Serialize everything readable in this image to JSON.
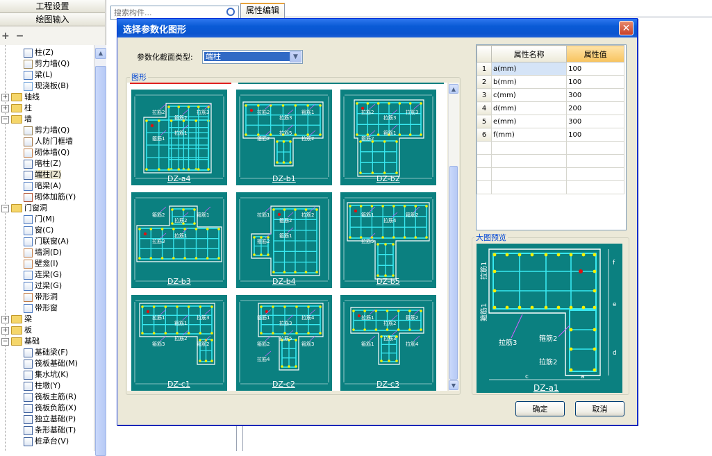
{
  "left_panel": {
    "header_top": "工程设置",
    "header_second": "绘图输入",
    "toolbar_add": "+",
    "toolbar_remove": "−",
    "tree": [
      {
        "label": "柱(Z)",
        "icon": "column-icon",
        "level": 2
      },
      {
        "label": "剪力墙(Q)",
        "icon": "shear-wall-icon",
        "level": 2
      },
      {
        "label": "梁(L)",
        "icon": "beam-icon",
        "level": 2
      },
      {
        "label": "现浇板(B)",
        "icon": "slab-icon",
        "level": 2
      },
      {
        "label": "轴线",
        "icon": "folder-icon",
        "level": 1,
        "expander": "+"
      },
      {
        "label": "柱",
        "icon": "folder-icon",
        "level": 1,
        "expander": "+"
      },
      {
        "label": "墙",
        "icon": "folder-icon",
        "level": 1,
        "expander": "−"
      },
      {
        "label": "剪力墙(Q)",
        "icon": "shear-wall-icon",
        "level": 2
      },
      {
        "label": "人防门框墙",
        "icon": "door-frame-wall-icon",
        "level": 2
      },
      {
        "label": "砌体墙(Q)",
        "icon": "masonry-wall-icon",
        "level": 2
      },
      {
        "label": "暗柱(Z)",
        "icon": "hidden-column-icon",
        "level": 2
      },
      {
        "label": "端柱(Z)",
        "icon": "end-column-icon",
        "level": 2
      },
      {
        "label": "暗梁(A)",
        "icon": "hidden-beam-icon",
        "level": 2
      },
      {
        "label": "砌体加筋(Y)",
        "icon": "masonry-rebar-icon",
        "level": 2
      },
      {
        "label": "门窗洞",
        "icon": "folder-icon",
        "level": 1,
        "expander": "−"
      },
      {
        "label": "门(M)",
        "icon": "door-icon",
        "level": 2
      },
      {
        "label": "窗(C)",
        "icon": "window-icon",
        "level": 2
      },
      {
        "label": "门联窗(A)",
        "icon": "door-window-icon",
        "level": 2
      },
      {
        "label": "墙洞(D)",
        "icon": "wall-hole-icon",
        "level": 2
      },
      {
        "label": "壁龛(I)",
        "icon": "niche-icon",
        "level": 2
      },
      {
        "label": "连梁(G)",
        "icon": "link-beam-icon",
        "level": 2
      },
      {
        "label": "过梁(G)",
        "icon": "lintel-icon",
        "level": 2
      },
      {
        "label": "带形洞",
        "icon": "strip-hole-icon",
        "level": 2
      },
      {
        "label": "带形窗",
        "icon": "strip-window-icon",
        "level": 2
      },
      {
        "label": "梁",
        "icon": "folder-icon",
        "level": 1,
        "expander": "+"
      },
      {
        "label": "板",
        "icon": "folder-icon",
        "level": 1,
        "expander": "+"
      },
      {
        "label": "基础",
        "icon": "folder-icon",
        "level": 1,
        "expander": "−"
      },
      {
        "label": "基础梁(F)",
        "icon": "foundation-beam-icon",
        "level": 2
      },
      {
        "label": "筏板基础(M)",
        "icon": "raft-foundation-icon",
        "level": 2
      },
      {
        "label": "集水坑(K)",
        "icon": "sump-icon",
        "level": 2
      },
      {
        "label": "柱墩(Y)",
        "icon": "pier-icon",
        "level": 2
      },
      {
        "label": "筏板主筋(R)",
        "icon": "raft-main-rebar-icon",
        "level": 2
      },
      {
        "label": "筏板负筋(X)",
        "icon": "raft-neg-rebar-icon",
        "level": 2
      },
      {
        "label": "独立基础(P)",
        "icon": "isolated-foundation-icon",
        "level": 2
      },
      {
        "label": "条形基础(T)",
        "icon": "strip-foundation-icon",
        "level": 2
      },
      {
        "label": "桩承台(V)",
        "icon": "pile-cap-icon",
        "level": 2
      }
    ]
  },
  "search": {
    "placeholder": "搜索构件..."
  },
  "tabs": [
    {
      "label": "属性编辑"
    }
  ],
  "dialog": {
    "title": "选择参数化图形",
    "type_label": "参数化截面类型:",
    "type_value": "端柱",
    "graph_group_label": "图形",
    "shapes": [
      {
        "name": "DZ-a4",
        "labels": [
          "拉筋2",
          "箍筋2",
          "拉筋3",
          "箍筋1",
          "拉筋1"
        ]
      },
      {
        "name": "DZ-b1",
        "labels": [
          "拉筋2",
          "拉筋3",
          "箍筋1",
          "箍筋2",
          "拉筋5",
          "拉筋2"
        ]
      },
      {
        "name": "DZ-b2",
        "labels": [
          "拉筋2",
          "拉筋3",
          "拉筋3",
          "箍筋2",
          "箍筋1"
        ]
      },
      {
        "name": "DZ-b3",
        "labels": [
          "箍筋2",
          "拉筋2",
          "箍筋1",
          "拉筋3",
          "拉筋1"
        ]
      },
      {
        "name": "DZ-b4",
        "labels": [
          "拉筋1",
          "箍筋2",
          "拉筋2",
          "箍筋2",
          "箍筋1"
        ]
      },
      {
        "name": "DZ-b5",
        "labels": [
          "箍筋1",
          "拉筋4",
          "箍筋2",
          "拉筋5"
        ]
      },
      {
        "name": "DZ-c1",
        "labels": [
          "拉筋1",
          "箍筋1",
          "拉筋3",
          "箍筋3",
          "拉筋2",
          "箍筋2"
        ]
      },
      {
        "name": "DZ-c2",
        "labels": [
          "箍筋1",
          "拉筋3",
          "拉筋4",
          "箍筋2",
          "拉筋5",
          "箍筋3",
          "拉筋4"
        ]
      },
      {
        "name": "DZ-c3",
        "labels": [
          "拉筋1",
          "拉筋2",
          "箍筋2",
          "箍筋1",
          "拉筋3",
          "拉筋4"
        ]
      }
    ],
    "properties": {
      "col_name": "属性名称",
      "col_value": "属性值",
      "rows": [
        {
          "idx": "1",
          "name": "a(mm)",
          "value": "100"
        },
        {
          "idx": "2",
          "name": "b(mm)",
          "value": "100"
        },
        {
          "idx": "3",
          "name": "c(mm)",
          "value": "300"
        },
        {
          "idx": "4",
          "name": "d(mm)",
          "value": "200"
        },
        {
          "idx": "5",
          "name": "e(mm)",
          "value": "300"
        },
        {
          "idx": "6",
          "name": "f(mm)",
          "value": "100"
        }
      ]
    },
    "preview_label": "大图预览",
    "preview": {
      "name": "DZ-a1",
      "labels": {
        "t1": "拉筋1",
        "t2": "箍筋1",
        "t3": "拉筋3",
        "t4": "箍筋2",
        "t5": "拉筋2"
      },
      "dims": {
        "c": "c",
        "a": "a",
        "f": "f",
        "e": "e",
        "d": "d"
      }
    },
    "ok_label": "确定",
    "cancel_label": "取消"
  },
  "colors": {
    "teal": "#0b8080",
    "rebar": "#38e8f0",
    "dot": "#f5f000",
    "red": "#e01010",
    "title_blue": "#0a5bd6"
  }
}
